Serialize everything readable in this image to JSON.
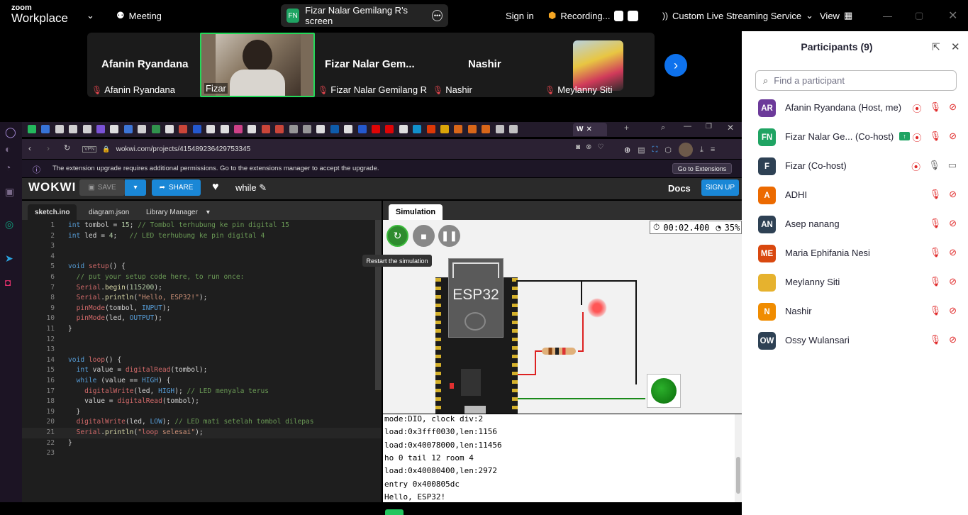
{
  "zoom": {
    "logo_top": "zoom",
    "logo_bottom": "Workplace",
    "meeting_label": "Meeting",
    "screen_badge": "FN",
    "screen_title": "Fizar Nalar Gemilang R's screen",
    "sign_in": "Sign in",
    "recording": "Recording...",
    "streaming": "Custom Live Streaming Service",
    "view": "View"
  },
  "strip": {
    "tiles": [
      {
        "name": "Afanin Ryandana",
        "sub": "Afanin Ryandana"
      },
      {
        "name": "",
        "sub": "Fizar"
      },
      {
        "name": "Fizar Nalar Gem...",
        "sub": "Fizar Nalar Gemilang R"
      },
      {
        "name": "Nashir",
        "sub": "Nashir"
      },
      {
        "name": "",
        "sub": "Meylanny Siti"
      }
    ]
  },
  "browser": {
    "vpn": "VPN",
    "url": "wokwi.com/projects/415489236429753345",
    "info": "The extension upgrade requires additional permissions. Go to the extensions manager to accept the upgrade.",
    "ext_button": "Go to Extensions"
  },
  "wokwi": {
    "logo": "WOKWI",
    "save": "SAVE",
    "share": "SHARE",
    "project": "while",
    "docs": "Docs",
    "signup": "SIGN UP",
    "tabs": [
      "sketch.ino",
      "diagram.json",
      "Library Manager"
    ],
    "sim_tab": "Simulation",
    "timer": "00:02.400",
    "speed": "35%",
    "tooltip": "Restart the simulation",
    "chip": "ESP32"
  },
  "code": [
    "int tombol = 15; // Tombol terhubung ke pin digital 15",
    "int led = 4;   // LED terhubung ke pin digital 4",
    "",
    "",
    "void setup() {",
    "  // put your setup code here, to run once:",
    "  Serial.begin(115200);",
    "  Serial.println(\"Hello, ESP32!\");",
    "  pinMode(tombol, INPUT);",
    "  pinMode(led, OUTPUT);",
    "}",
    "",
    "",
    "void loop() {",
    "  int value = digitalRead(tombol);",
    "  while (value == HIGH) {",
    "    digitalWrite(led, HIGH); // LED menyala terus",
    "    value = digitalRead(tombol);",
    "  }",
    "  digitalWrite(led, LOW); // LED mati setelah tombol dilepas",
    "  Serial.println(\"loop selesai\");",
    "}",
    ""
  ],
  "serial": [
    "mode:DIO, clock div:2",
    "load:0x3fff0030,len:1156",
    "load:0x40078000,len:11456",
    "ho 0 tail 12 room 4",
    "load:0x40080400,len:2972",
    "entry 0x400805dc",
    "Hello, ESP32!"
  ],
  "panel": {
    "title": "Participants (9)",
    "search_placeholder": "Find a participant",
    "participants": [
      {
        "initials": "AR",
        "name": "Afanin Ryandana (Host, me)",
        "color": "#6c3a9a"
      },
      {
        "initials": "FN",
        "name": "Fizar Nalar Ge... (Co-host)",
        "color": "#1fa463"
      },
      {
        "initials": "F",
        "name": "Fizar (Co-host)",
        "color": "#2e4154"
      },
      {
        "initials": "A",
        "name": "ADHI",
        "color": "#ec6a00"
      },
      {
        "initials": "AN",
        "name": "Asep nanang",
        "color": "#2e4154"
      },
      {
        "initials": "ME",
        "name": "Maria Ephifania Nesi",
        "color": "#d9480f"
      },
      {
        "initials": "",
        "name": "Meylanny Siti",
        "color": "#e6b22e"
      },
      {
        "initials": "N",
        "name": "Nashir",
        "color": "#f08c00"
      },
      {
        "initials": "OW",
        "name": "Ossy Wulansari",
        "color": "#2e4154"
      }
    ]
  }
}
